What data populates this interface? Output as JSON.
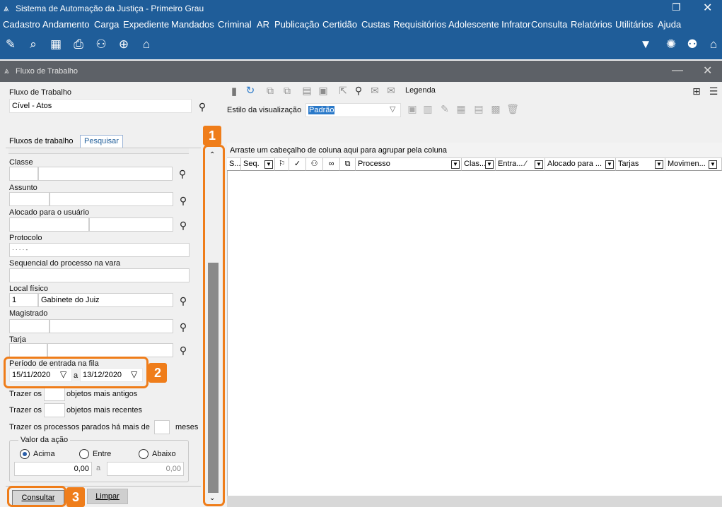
{
  "app": {
    "title": "Sistema de Automação da Justiça - Primeiro Grau",
    "window_controls": [
      "restore-icon",
      "close-icon"
    ]
  },
  "menu": [
    "Cadastro",
    "Andamento",
    "Carga",
    "Expediente",
    "Mandados",
    "Criminal",
    "AR",
    "Publicação",
    "Certidão",
    "Custas",
    "Requisitórios",
    "Adolescente Infrator",
    "Consulta",
    "Relatórios",
    "Utilitários",
    "Ajuda"
  ],
  "subwindow": {
    "title": "Fluxo de Trabalho"
  },
  "left": {
    "fluxo_label": "Fluxo de Trabalho",
    "fluxo_value": "Cível - Atos",
    "tabs": [
      "Fluxos de trabalho",
      "Pesquisar"
    ],
    "active_tab": "Pesquisar",
    "classe_label": "Classe",
    "assunto_label": "Assunto",
    "alocado_label": "Alocado para o usuário",
    "protocolo_label": "Protocolo",
    "protocolo_value": "· · · · -",
    "sequencial_label": "Sequencial do processo na vara",
    "local_label": "Local físico",
    "local_code": "1",
    "local_value": "Gabinete do Juiz",
    "magistrado_label": "Magistrado",
    "tarja_label": "Tarja",
    "periodo_label": "Período de entrada na fila",
    "periodo_start": "15/11/2020",
    "periodo_sep": "a",
    "periodo_end": "13/12/2020",
    "trazer_os": "Trazer os",
    "mais_antigos": "objetos mais antigos",
    "mais_recentes": "objetos mais recentes",
    "parados_label": "Trazer os processos parados há mais de",
    "meses": "meses",
    "valor_label": "Valor da ação",
    "radio_acima": "Acima",
    "radio_entre": "Entre",
    "radio_abaixo": "Abaixo",
    "valor_min": "0,00",
    "valor_sep": "a",
    "valor_max": "0,00",
    "consultar": "Consultar",
    "limpar": "Limpar"
  },
  "right": {
    "legenda": "Legenda",
    "estilo_label": "Estilo da visualização",
    "estilo_value": "Padrão",
    "group_hint": "Arraste um cabeçalho de coluna aqui para agrupar pela coluna",
    "columns": [
      "S...",
      "Seq.",
      "Processo",
      "Clas...",
      "Entra... ⁄",
      "Alocado para ...",
      "Tarjas",
      "Movimen..."
    ]
  },
  "callouts": [
    "1",
    "2",
    "3"
  ],
  "colors": {
    "accent": "#1f5d99",
    "highlight": "#ef7d1a",
    "subtitle_bar": "#5d6167"
  }
}
